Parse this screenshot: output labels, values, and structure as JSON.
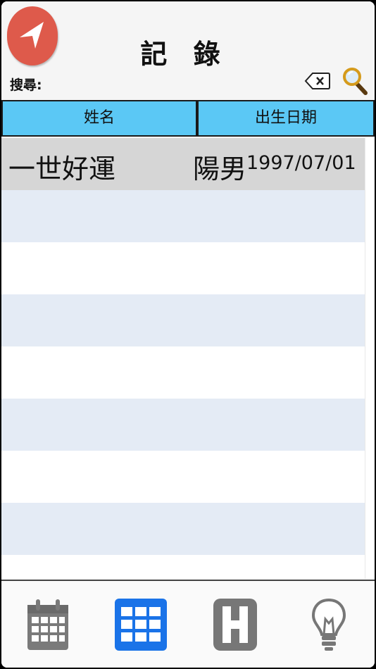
{
  "header": {
    "title": "記 錄",
    "search_label": "搜尋:",
    "search_value": "",
    "back_icon": "back-arrow-icon",
    "clear_icon": "clear-backspace-icon",
    "search_icon": "magnifier-icon"
  },
  "columns": {
    "name": "姓名",
    "dob": "出生日期"
  },
  "rows": [
    {
      "name": "一世好運",
      "hour": "陽男",
      "date": "1997/07/01"
    }
  ],
  "tabs": [
    {
      "icon": "calendar-icon",
      "active": false
    },
    {
      "icon": "grid-icon",
      "active": true
    },
    {
      "icon": "h-icon",
      "active": false
    },
    {
      "icon": "lightbulb-icon",
      "active": false
    }
  ],
  "colors": {
    "back_button": "#de5a4b",
    "header_cells": "#5bc8f5",
    "selected_row": "#d6d6d6",
    "alternate_row": "#e4ebf5",
    "active_tab": "#1a73e8",
    "inactive_tab": "#777777"
  }
}
